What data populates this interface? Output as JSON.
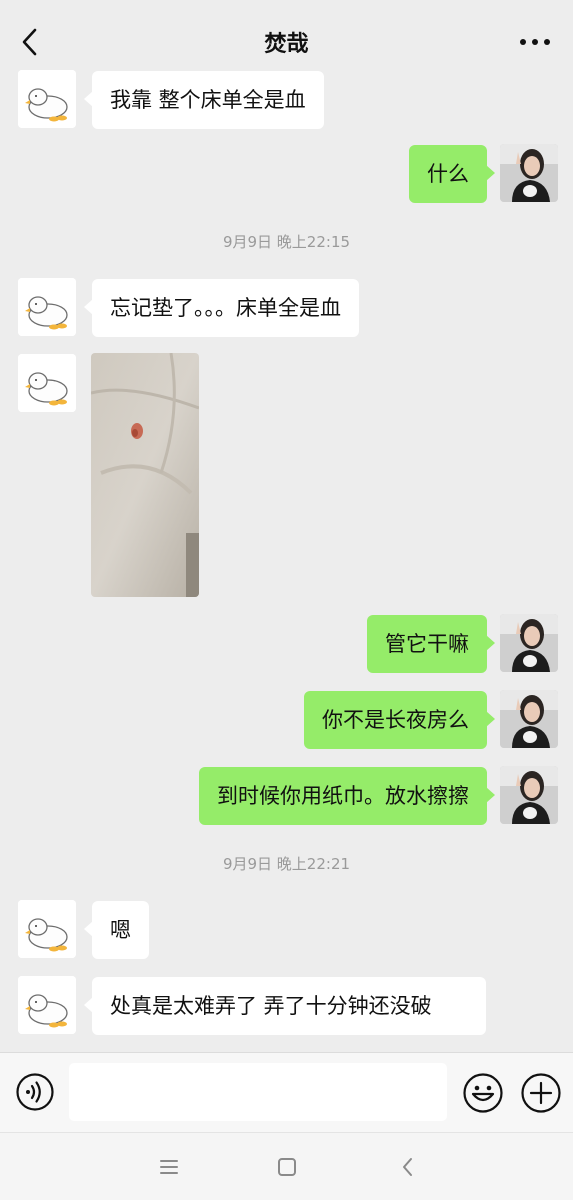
{
  "header": {
    "title": "焚哉",
    "back_icon": "chevron-left-icon",
    "more_icon": "more-dots-icon"
  },
  "contact_avatar": "duck-sticker-avatar",
  "self_avatar": "selfie-photo-avatar",
  "messages": [
    {
      "side": "left",
      "text": "我靠  整个床单全是血"
    },
    {
      "side": "right",
      "text": "什么"
    },
    {
      "side": "time",
      "text": "9月9日 晚上22:15"
    },
    {
      "side": "left",
      "text": "忘记垫了。。。床单全是血"
    },
    {
      "side": "left",
      "type": "image",
      "description_icon": "photo-thumbnail"
    },
    {
      "side": "right",
      "text": "管它干嘛"
    },
    {
      "side": "right",
      "text": "你不是长夜房么"
    },
    {
      "side": "right",
      "text": "到时候你用纸巾。放水擦擦"
    },
    {
      "side": "time",
      "text": "9月9日 晚上22:21"
    },
    {
      "side": "left",
      "text": "嗯"
    },
    {
      "side": "left",
      "text": "处真是太难弄了  弄了十分钟还没破"
    }
  ],
  "input_bar": {
    "voice_icon": "voice-icon",
    "input_value": "",
    "emoji_icon": "emoji-icon",
    "plus_icon": "plus-icon"
  },
  "system_nav": {
    "menu_icon": "menu-icon",
    "home_icon": "home-square-icon",
    "back_icon": "back-chevron-icon"
  },
  "colors": {
    "background": "#ededed",
    "self_bubble": "#95ec69",
    "other_bubble": "#ffffff",
    "timestamp_text": "#9a9a9a"
  }
}
